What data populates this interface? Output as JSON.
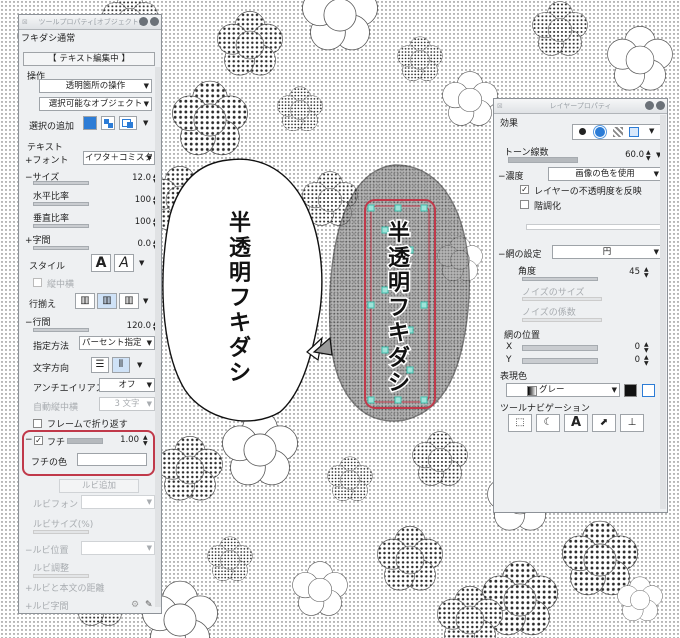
{
  "left_panel": {
    "title": "ツールプロパティ[オブジェクト]",
    "tool_name": "フキダシ通常",
    "edit_badge": "【 テキスト編集中 】",
    "operation": {
      "heading": "操作",
      "transparent_op": "透明箇所の操作",
      "selectable_obj": "選択可能なオブジェクト",
      "add_selection_label": "選択の追加"
    },
    "text": {
      "heading": "テキスト",
      "font_label": "フォント",
      "font_value": "イワタ＋コミスタ",
      "size_label": "サイズ",
      "size_value": "12.0",
      "hratio_label": "水平比率",
      "hratio_value": "100",
      "vratio_label": "垂直比率",
      "vratio_value": "100",
      "spacing_label": "字間",
      "spacing_value": "0.0",
      "style_label": "スタイル",
      "tate_label": "縦中横",
      "align_label": "行揃え",
      "leading_label": "行間",
      "leading_value": "120.0",
      "spec_label": "指定方法",
      "spec_value": "パーセント指定",
      "direction_label": "文字方向",
      "aa_label": "アンチエイリアス",
      "aa_value": "オフ",
      "auto_tate_label": "自動縦中横",
      "auto_tate_value": "3 文字",
      "wrap_label": "フレームで折り返す",
      "edge_label": "フチ",
      "edge_value": "1.00",
      "edge_color_label": "フチの色",
      "ruby_ghost": "ルビ追加",
      "ruby_font_label": "ルビフォント",
      "ruby_size_label": "ルビサイズ(%)",
      "ruby_pos_label": "ルビ位置",
      "ruby_adjust_label": "ルビ調整",
      "ruby_distance_label": "ルビと本文の距離",
      "ruby_space_label": "ルビ字間"
    }
  },
  "right_panel": {
    "title": "レイヤープロパティ",
    "effect_heading": "効果",
    "tone_lines_label": "トーン線数",
    "tone_lines_value": "60.0",
    "density_label": "濃度",
    "density_value": "画像の色を使用",
    "reflect_label": "レイヤーの不透明度を反映",
    "posterize_label": "階調化",
    "dot_label": "網の設定",
    "dot_value": "円",
    "angle_label": "角度",
    "angle_value": "45",
    "noise_size_label": "ノイズのサイズ",
    "noise_factor_label": "ノイズの係数",
    "dot_pos_label": "網の位置",
    "x_label": "X",
    "x_value": "0",
    "y_label": "Y",
    "y_value": "0",
    "expression_label": "表現色",
    "expression_value": "グレー",
    "toolnav_label": "ツールナビゲーション"
  },
  "canvas": {
    "balloon_text": [
      "半",
      "透",
      "明",
      "フ",
      "キ",
      "ダ",
      "シ"
    ],
    "highlight_color": "#c0394a",
    "selection_color": "#3fbfad"
  }
}
